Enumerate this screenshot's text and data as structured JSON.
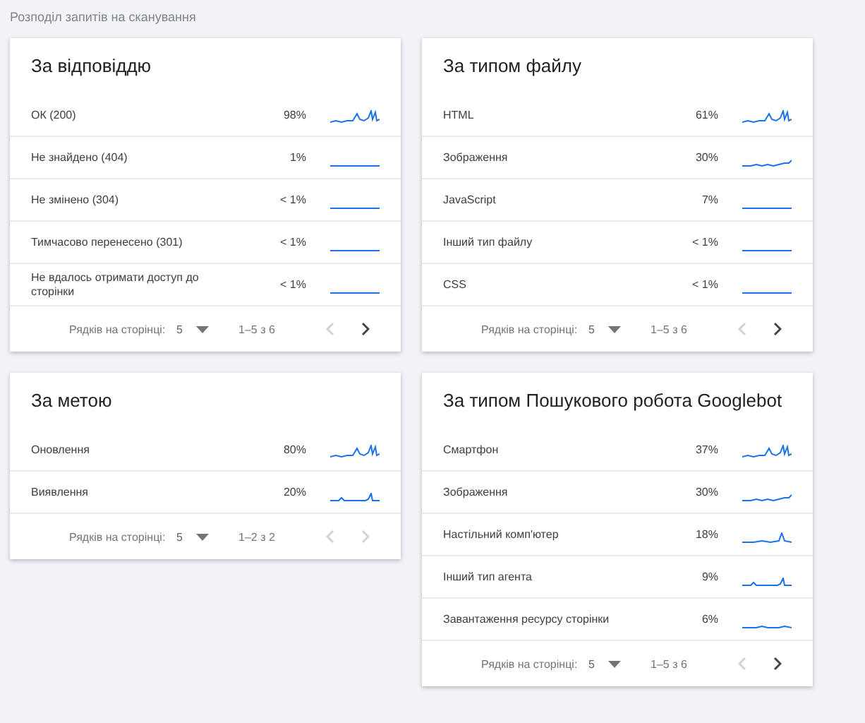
{
  "section_title": "Розподіл запитів на сканування",
  "cards": [
    {
      "title": "За відповіддю",
      "rows": [
        {
          "label": "ОК (200)",
          "percent": "98%",
          "kind": "spiky"
        },
        {
          "label": "Не знайдено (404)",
          "percent": "1%",
          "kind": "flat"
        },
        {
          "label": "Не змінено (304)",
          "percent": "< 1%",
          "kind": "flat"
        },
        {
          "label": "Тимчасово перенесено (301)",
          "percent": "< 1%",
          "kind": "flat"
        },
        {
          "label": "Не вдалось отримати доступ до сторінки",
          "percent": "< 1%",
          "kind": "flat"
        }
      ],
      "pagination": {
        "rows_label": "Рядків на сторінці:",
        "rows_per_page": "5",
        "range": "1–5 з 6",
        "prev_disabled": true,
        "next_disabled": false
      }
    },
    {
      "title": "За типом файлу",
      "rows": [
        {
          "label": "HTML",
          "percent": "61%",
          "kind": "spiky"
        },
        {
          "label": "Зображення",
          "percent": "30%",
          "kind": "rising"
        },
        {
          "label": "JavaScript",
          "percent": "7%",
          "kind": "flat"
        },
        {
          "label": "Інший тип файлу",
          "percent": "< 1%",
          "kind": "flat"
        },
        {
          "label": "CSS",
          "percent": "< 1%",
          "kind": "flat"
        }
      ],
      "pagination": {
        "rows_label": "Рядків на сторінці:",
        "rows_per_page": "5",
        "range": "1–5 з 6",
        "prev_disabled": true,
        "next_disabled": false
      }
    },
    {
      "title": "За метою",
      "rows": [
        {
          "label": "Оновлення",
          "percent": "80%",
          "kind": "spiky"
        },
        {
          "label": "Виявлення",
          "percent": "20%",
          "kind": "bumpy"
        }
      ],
      "pagination": {
        "rows_label": "Рядків на сторінці:",
        "rows_per_page": "5",
        "range": "1–2 з 2",
        "prev_disabled": true,
        "next_disabled": true
      }
    },
    {
      "title": "За типом Пошукового робота Googlebot",
      "rows": [
        {
          "label": "Смартфон",
          "percent": "37%",
          "kind": "spiky"
        },
        {
          "label": "Зображення",
          "percent": "30%",
          "kind": "rising"
        },
        {
          "label": "Настільний комп'ютер",
          "percent": "18%",
          "kind": "peak"
        },
        {
          "label": "Інший тип агента",
          "percent": "9%",
          "kind": "bumpy"
        },
        {
          "label": "Завантаження ресурсу сторінки",
          "percent": "6%",
          "kind": "low"
        }
      ],
      "pagination": {
        "rows_label": "Рядків на сторінці:",
        "rows_per_page": "5",
        "range": "1–5 з 6",
        "prev_disabled": true,
        "next_disabled": false
      }
    }
  ]
}
